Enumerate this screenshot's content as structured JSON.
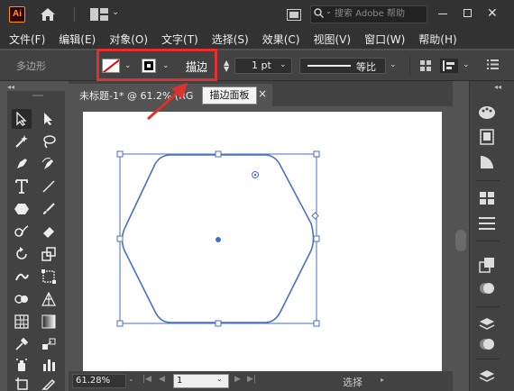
{
  "app": {
    "logo": "Ai",
    "search_placeholder": "搜索 Adobe 帮助"
  },
  "menu": [
    "文件(F)",
    "编辑(E)",
    "对象(O)",
    "文字(T)",
    "选择(S)",
    "效果(C)",
    "视图(V)",
    "窗口(W)",
    "帮助(H)"
  ],
  "control_bar": {
    "object_type": "多边形",
    "stroke_label": "描边",
    "stroke_separator": ":",
    "stroke_weight": "1 pt",
    "profile_label": "等比"
  },
  "tooltip": "描边面板",
  "document_tab": {
    "title": "未标题-1* @ 61.2% (RG",
    "close": "×"
  },
  "status_bar": {
    "zoom": "61.28%",
    "page": "1",
    "status": "选择",
    "nav_first": "|◀",
    "nav_prev": "◀",
    "nav_next": "▶",
    "nav_last": "▶|"
  },
  "colors": {
    "accent_annotation": "#e0312f",
    "shape_stroke": "#4a6fc8",
    "selection": "#4a6fc8"
  },
  "toolbar_icons": [
    "selection-tool",
    "direct-selection-tool",
    "magic-wand-tool",
    "lasso-tool",
    "pen-tool",
    "curvature-tool",
    "type-tool",
    "line-tool",
    "polygon-tool",
    "paintbrush-tool",
    "shaper-tool",
    "eraser-tool",
    "rotate-tool",
    "scale-tool",
    "warp-tool",
    "free-transform-tool",
    "shape-builder-tool",
    "perspective-grid-tool",
    "mesh-tool",
    "gradient-tool",
    "eyedropper-tool",
    "blend-tool",
    "symbol-sprayer-tool",
    "column-graph-tool",
    "artboard-tool",
    "slice-tool"
  ],
  "right_panel_icons": [
    "color-guide-icon",
    "properties-icon",
    "transparency-icon",
    "swatches-icon",
    "align-panel-icon",
    "pathfinder-icon",
    "appearance-icon",
    "layers-icon",
    "libraries-icon"
  ]
}
